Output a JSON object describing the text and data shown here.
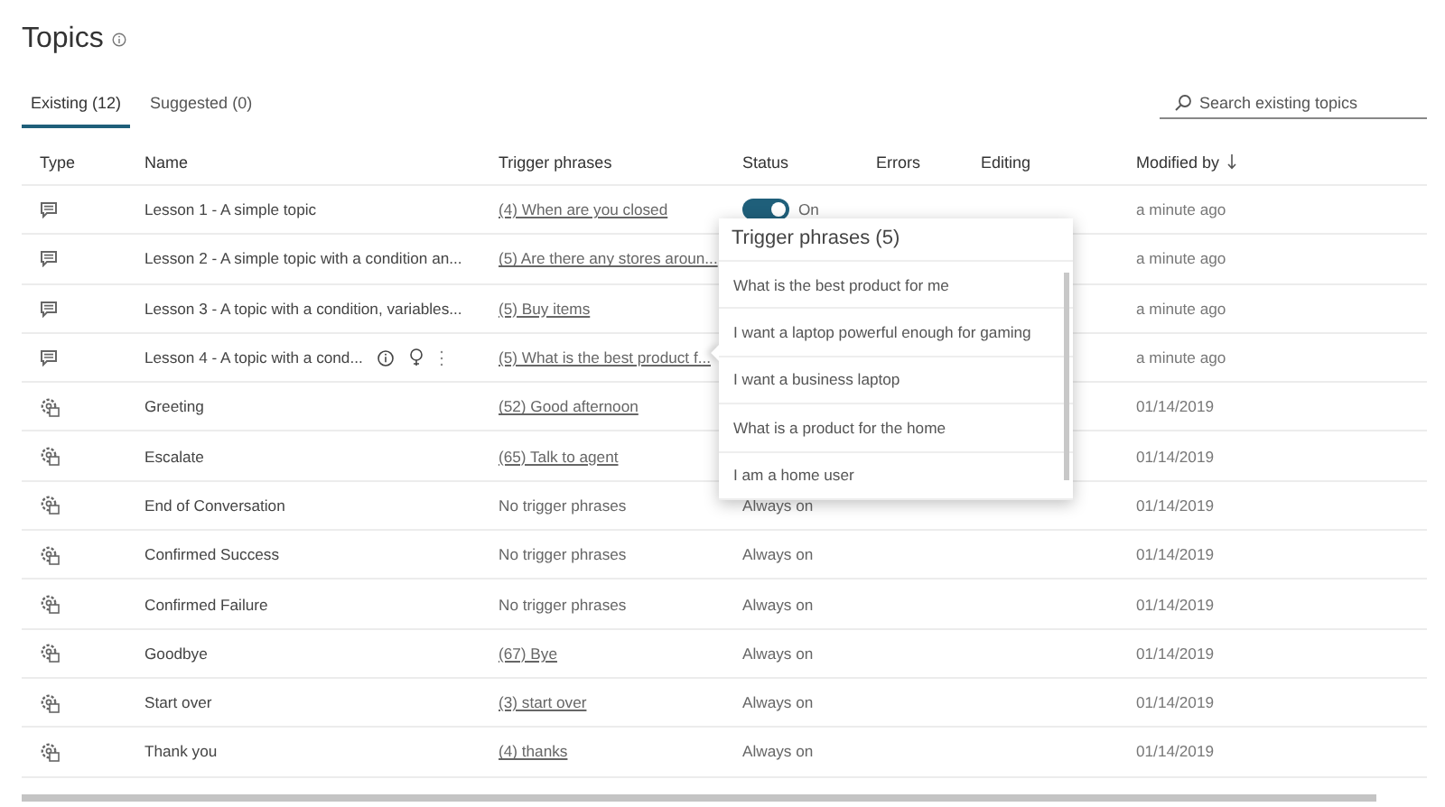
{
  "page": {
    "title": "Topics"
  },
  "tabs": [
    {
      "label": "Existing (12)",
      "selected": true
    },
    {
      "label": "Suggested (0)",
      "selected": false
    }
  ],
  "search": {
    "placeholder": "Search existing topics"
  },
  "table": {
    "columns": [
      "Type",
      "Name",
      "Trigger phrases",
      "Status",
      "Errors",
      "Editing",
      "Modified by"
    ],
    "rows": [
      {
        "kind": "lesson",
        "name": "Lesson 1 - A simple topic",
        "trigger": {
          "text": "(4) When are you closed",
          "linked": true
        },
        "status": {
          "kind": "toggle",
          "on": true,
          "label": "On"
        },
        "modified": "a minute ago",
        "hovered": false
      },
      {
        "kind": "lesson",
        "name": "Lesson 2 - A simple topic with a condition an...",
        "trigger": {
          "text": "(5) Are there any stores aroun...",
          "linked": true
        },
        "modified": "a minute ago",
        "hovered": false
      },
      {
        "kind": "lesson",
        "name": "Lesson 3 - A topic with a condition, variables...",
        "trigger": {
          "text": "(5) Buy items",
          "linked": true
        },
        "modified": "a minute ago",
        "hovered": false
      },
      {
        "kind": "lesson",
        "name": "Lesson 4 - A topic with a cond...",
        "trigger": {
          "text": "(5) What is the best product f...",
          "linked": true
        },
        "modified": "a minute ago",
        "hovered": true
      },
      {
        "kind": "system",
        "name": "Greeting",
        "trigger": {
          "text": "(52) Good afternoon",
          "linked": true
        },
        "modified": "01/14/2019",
        "hovered": false
      },
      {
        "kind": "system",
        "name": "Escalate",
        "trigger": {
          "text": "(65) Talk to agent",
          "linked": true
        },
        "modified": "01/14/2019",
        "hovered": false
      },
      {
        "kind": "system",
        "name": "End of Conversation",
        "trigger": {
          "text": "No trigger phrases",
          "linked": false
        },
        "status": {
          "kind": "text",
          "label": "Always on"
        },
        "modified": "01/14/2019",
        "hovered": false
      },
      {
        "kind": "system",
        "name": "Confirmed Success",
        "trigger": {
          "text": "No trigger phrases",
          "linked": false
        },
        "status": {
          "kind": "text",
          "label": "Always on"
        },
        "modified": "01/14/2019",
        "hovered": false
      },
      {
        "kind": "system",
        "name": "Confirmed Failure",
        "trigger": {
          "text": "No trigger phrases",
          "linked": false
        },
        "status": {
          "kind": "text",
          "label": "Always on"
        },
        "modified": "01/14/2019",
        "hovered": false
      },
      {
        "kind": "system",
        "name": "Goodbye",
        "trigger": {
          "text": "(67) Bye",
          "linked": true
        },
        "status": {
          "kind": "text",
          "label": "Always on"
        },
        "modified": "01/14/2019",
        "hovered": false
      },
      {
        "kind": "system",
        "name": "Start over",
        "trigger": {
          "text": "(3) start over",
          "linked": true
        },
        "status": {
          "kind": "text",
          "label": "Always on"
        },
        "modified": "01/14/2019",
        "hovered": false
      },
      {
        "kind": "system",
        "name": "Thank you",
        "trigger": {
          "text": "(4) thanks",
          "linked": true
        },
        "status": {
          "kind": "text",
          "label": "Always on"
        },
        "modified": "01/14/2019",
        "hovered": false
      }
    ]
  },
  "popup": {
    "title": "Trigger phrases (5)",
    "phrases": [
      "What is the best product for me",
      "I want a laptop powerful enough for gaming",
      "I want a business laptop",
      "What is a product for the home",
      "I am a home user"
    ]
  }
}
